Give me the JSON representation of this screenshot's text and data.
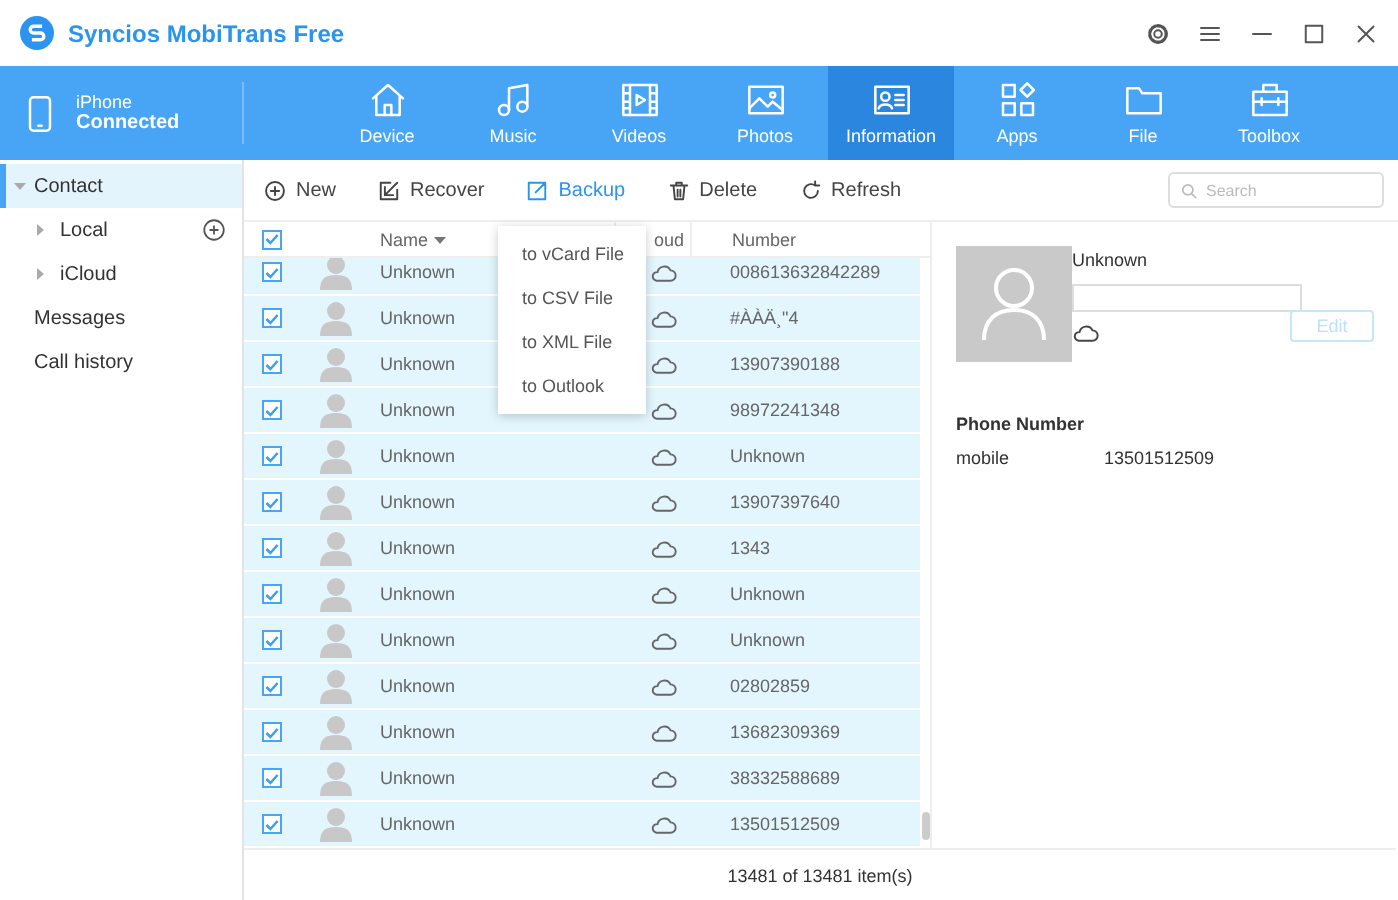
{
  "window": {
    "title": "Syncios MobiTrans Free"
  },
  "device": {
    "name": "iPhone",
    "status": "Connected"
  },
  "nav": [
    {
      "label": "Device",
      "selected": false
    },
    {
      "label": "Music",
      "selected": false
    },
    {
      "label": "Videos",
      "selected": false
    },
    {
      "label": "Photos",
      "selected": false
    },
    {
      "label": "Information",
      "selected": true
    },
    {
      "label": "Apps",
      "selected": false
    },
    {
      "label": "File",
      "selected": false
    },
    {
      "label": "Toolbox",
      "selected": false
    }
  ],
  "sidebar": {
    "items": [
      {
        "label": "Contact",
        "selected": true,
        "expanded": true,
        "children": [
          {
            "label": "Local",
            "selected": false,
            "expanded": false,
            "add": true
          },
          {
            "label": "iCloud",
            "selected": false,
            "expanded": false
          }
        ]
      },
      {
        "label": "Messages",
        "selected": false
      },
      {
        "label": "Call history",
        "selected": false
      }
    ]
  },
  "toolbar": {
    "buttons": [
      {
        "label": "New",
        "active": false
      },
      {
        "label": "Recover",
        "active": false
      },
      {
        "label": "Backup",
        "active": true
      },
      {
        "label": "Delete",
        "active": false
      },
      {
        "label": "Refresh",
        "active": false
      }
    ],
    "search": {
      "placeholder": "Search"
    }
  },
  "backup_menu": [
    "to vCard File",
    "to CSV File",
    "to XML File",
    "to Outlook"
  ],
  "table": {
    "all_checked": true,
    "columns": [
      "Name",
      "oud",
      "Number"
    ],
    "rows": [
      {
        "name": "Unknown",
        "number": "008613632842289",
        "checked": true
      },
      {
        "name": "Unknown",
        "number": "#ÀÀÄ¸\"4",
        "checked": true
      },
      {
        "name": "Unknown",
        "number": "13907390188",
        "checked": true
      },
      {
        "name": "Unknown",
        "number": "98972241348",
        "checked": true
      },
      {
        "name": "Unknown",
        "number": "Unknown",
        "checked": true
      },
      {
        "name": "Unknown",
        "number": "13907397640",
        "checked": true
      },
      {
        "name": "Unknown",
        "number": "1343",
        "checked": true
      },
      {
        "name": "Unknown",
        "number": "Unknown",
        "checked": true
      },
      {
        "name": "Unknown",
        "number": "Unknown",
        "checked": true
      },
      {
        "name": "Unknown",
        "number": "02802859",
        "checked": true
      },
      {
        "name": "Unknown",
        "number": "13682309369",
        "checked": true
      },
      {
        "name": "Unknown",
        "number": "38332588689",
        "checked": true
      },
      {
        "name": "Unknown",
        "number": "13501512509",
        "checked": true
      }
    ],
    "footer": "13481 of 13481 item(s)"
  },
  "detail": {
    "name": "Unknown",
    "edit": "Edit",
    "section": "Phone Number",
    "phones": [
      {
        "label": "mobile",
        "number": "13501512509"
      }
    ]
  }
}
